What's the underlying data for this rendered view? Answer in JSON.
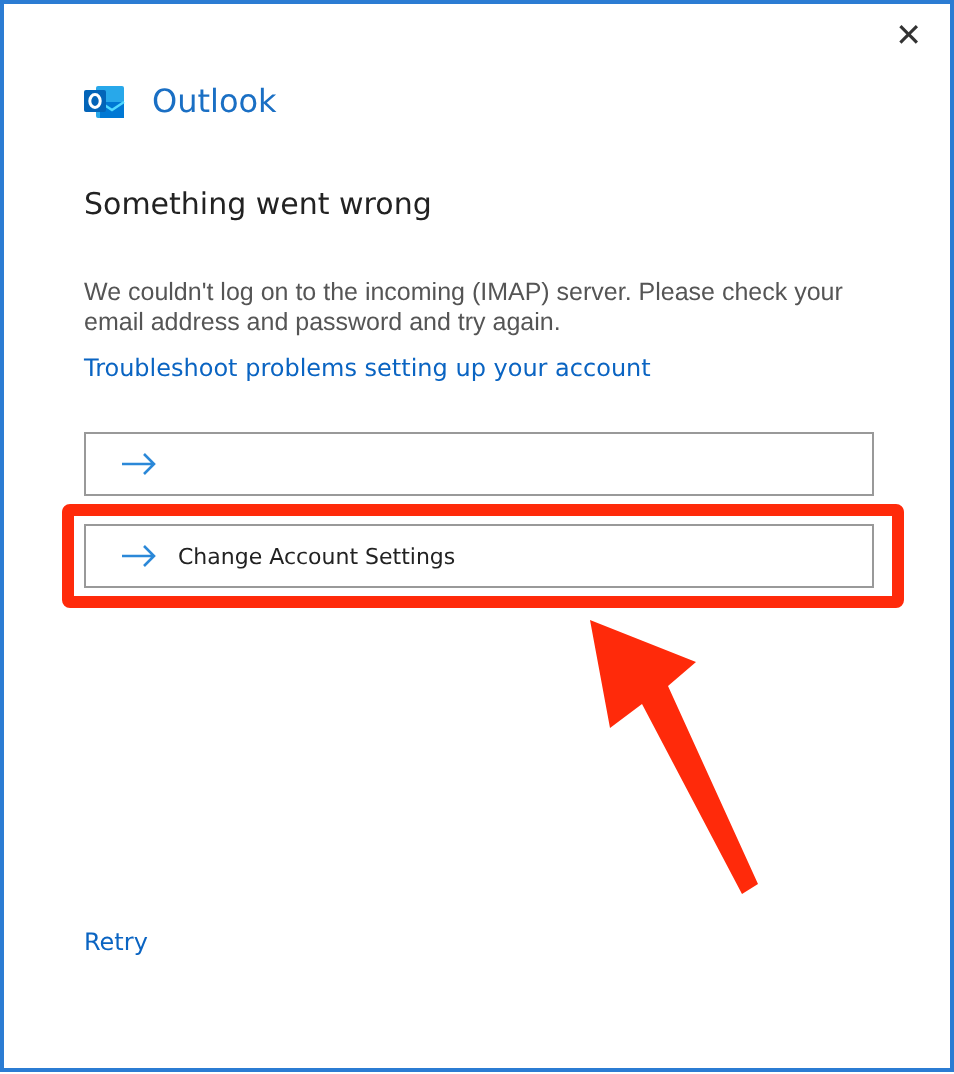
{
  "window": {
    "close_glyph": "✕"
  },
  "app": {
    "name": "Outlook"
  },
  "heading": "Something went wrong",
  "message": "We couldn't log on to the incoming (IMAP) server. Please check your email address and password and try again.",
  "help_link": "Troubleshoot problems setting up your account",
  "options": [
    {
      "kind": "empty",
      "highlighted": false
    },
    {
      "kind": "labeled",
      "label": "Change Account Settings",
      "highlighted": true
    }
  ],
  "footer_link": "Retry"
}
